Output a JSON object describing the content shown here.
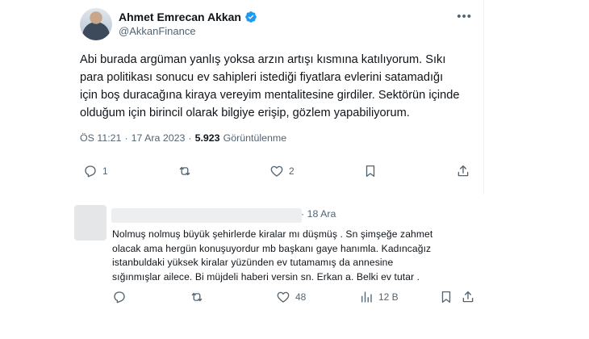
{
  "tweet": {
    "author_name": "Ahmet Emrecan Akkan",
    "handle": "@AkkanFinance",
    "text": "Abi burada argüman yanlış yoksa arzın artışı kısmına katılıyorum. Sıkı\npara politikası sonucu ev sahipleri istediği fiyatlara evlerini satamadığı\niçin boş duracağına kiraya vereyim mentalitesine girdiler. Sektörün içinde\nolduğum için birincil olarak bilgiye erişip, gözlem yapabiliyorum.",
    "time": "ÖS 11:21",
    "separator": "·",
    "date": "17 Ara 2023",
    "views_count": "5.923",
    "views_label": "Görüntülenme",
    "more_icon": "•••",
    "actions": {
      "reply_count": "1",
      "retweet_count": "",
      "like_count": "2"
    },
    "accent_color": "#1d9bf0"
  },
  "reply": {
    "time": "· 18 Ara",
    "text": "Nolmuş nolmuş büyük şehirlerde kiralar mı düşmüş . Sn şimşeğe zahmet\nolacak ama hergün konuşuyordur mb başkanı gaye hanımla. Kadıncağız\nistanbuldaki yüksek kiralar yüzünden ev tutamamış da annesine\nsığınmışlar ailece. Bi müjdeli haberi versin sn. Erkan a. Belki ev tutar .",
    "actions": {
      "reply_count": "",
      "retweet_count": "",
      "like_count": "48",
      "views_count": "12 B"
    }
  }
}
